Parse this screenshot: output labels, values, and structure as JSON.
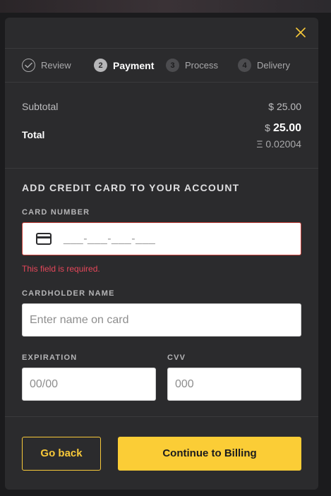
{
  "header": {
    "close_icon": "close-icon",
    "accent_color": "#f8c93a"
  },
  "steps": [
    {
      "number": "",
      "label": "Review",
      "state": "done"
    },
    {
      "number": "2",
      "label": "Payment",
      "state": "active"
    },
    {
      "number": "3",
      "label": "Process",
      "state": "pending"
    },
    {
      "number": "4",
      "label": "Delivery",
      "state": "pending"
    }
  ],
  "summary": {
    "subtotal_label": "Subtotal",
    "subtotal_value": "$ 25.00",
    "total_label": "Total",
    "total_currency": "$",
    "total_value": "25.00",
    "total_eth": "Ξ 0.02004"
  },
  "form": {
    "title": "ADD CREDIT CARD TO YOUR ACCOUNT",
    "card_number_label": "CARD NUMBER",
    "card_number_value": "___-___-___-___",
    "card_error": "This field is required.",
    "cardholder_label": "CARDHOLDER NAME",
    "cardholder_placeholder": "Enter name on card",
    "expiration_label": "EXPIRATION",
    "expiration_placeholder": "00/00",
    "cvv_label": "CVV",
    "cvv_placeholder": "000",
    "error_color": "#e6475a"
  },
  "footer": {
    "back_label": "Go back",
    "continue_label": "Continue to Billing",
    "button_color": "#fbcd36"
  }
}
